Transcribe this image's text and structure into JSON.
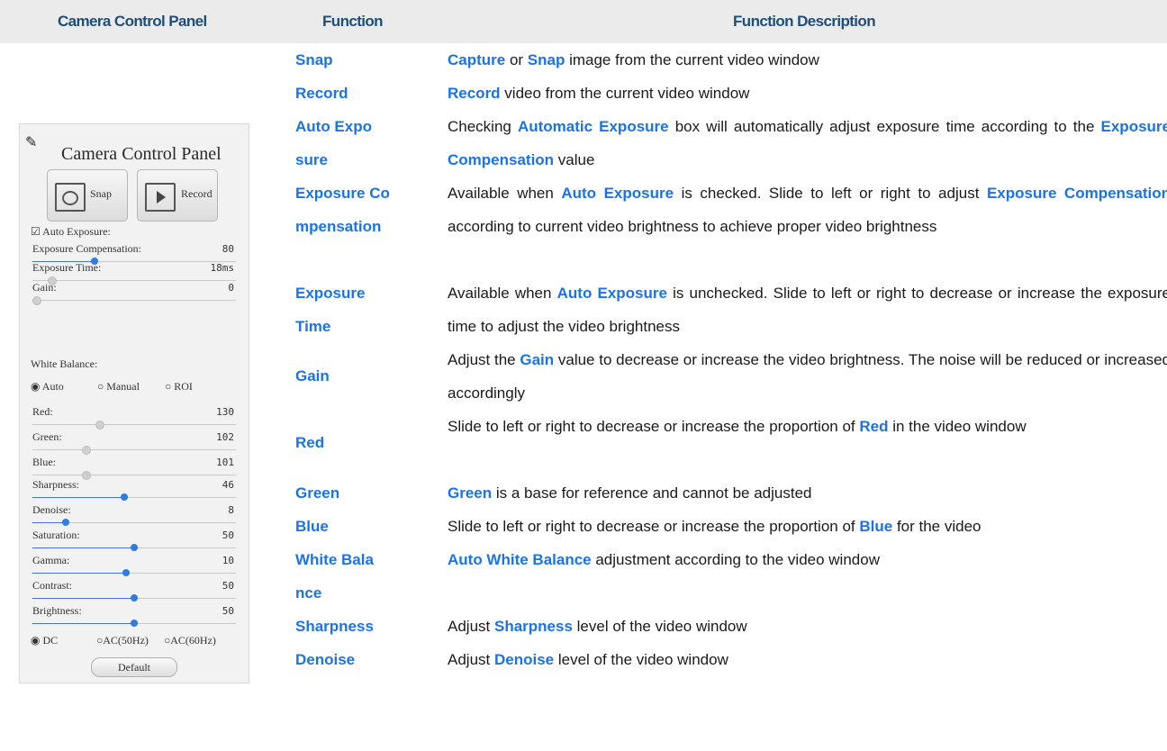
{
  "header": {
    "col1": "Camera Control Panel",
    "col2": "Function",
    "col3": "Function Description"
  },
  "panel": {
    "title": "Camera Control Panel",
    "snap_label": "Snap",
    "record_label": "Record",
    "auto_exposure": "☑ Auto Exposure:",
    "sliders": [
      {
        "label": "Exposure Compensation:",
        "value": "80",
        "level": 0.3
      },
      {
        "label": "Exposure Time:",
        "value": "18ms",
        "level": 0.08
      },
      {
        "label": "Gain:",
        "value": "0",
        "level": 0.0
      }
    ],
    "white_balance": "White Balance:",
    "wb_options": [
      "◉ Auto",
      "○ Manual",
      "○ ROI"
    ],
    "wb_sliders": [
      {
        "label": "Red:",
        "value": "130",
        "level": 0.32
      },
      {
        "label": "Green:",
        "value": "102",
        "level": 0.25
      },
      {
        "label": "Blue:",
        "value": "101",
        "level": 0.25
      }
    ],
    "adj_sliders": [
      {
        "label": "Sharpness:",
        "value": "46",
        "level": 0.45
      },
      {
        "label": "Denoise:",
        "value": "8",
        "level": 0.15
      },
      {
        "label": "Saturation:",
        "value": "50",
        "level": 0.5
      },
      {
        "label": "Gamma:",
        "value": "10",
        "level": 0.46
      },
      {
        "label": "Contrast:",
        "value": "50",
        "level": 0.5
      },
      {
        "label": "Brightness:",
        "value": "50",
        "level": 0.5
      }
    ],
    "power_options": [
      "◉ DC",
      "○AC(50Hz)",
      "○AC(60Hz)"
    ],
    "default_label": "Default"
  },
  "rows": [
    {
      "fn": "Snap",
      "desc": [
        {
          "t": "Capture",
          "h": true
        },
        {
          "t": " or "
        },
        {
          "t": "Snap",
          "h": true
        },
        {
          "t": " image from the current video window"
        }
      ]
    },
    {
      "fn": "Record",
      "desc": [
        {
          "t": "Record",
          "h": true
        },
        {
          "t": " video from the current video window"
        }
      ]
    },
    {
      "fn": "Auto Exposure",
      "desc": [
        {
          "t": "Checking "
        },
        {
          "t": "Automatic Exposure",
          "h": true
        },
        {
          "t": " box will automatically adjust exposure time according to the "
        },
        {
          "t": "Exposure Compensation",
          "h": true
        },
        {
          "t": " value"
        }
      ]
    },
    {
      "fn": "Exposure Compensation",
      "desc": [
        {
          "t": "Available when "
        },
        {
          "t": "Auto Exposure",
          "h": true
        },
        {
          "t": " is checked. Slide to left or right to adjust "
        },
        {
          "t": "Exposure Compensation",
          "h": true
        },
        {
          "t": " according to current video brightness to achieve proper video brightness"
        }
      ]
    },
    {
      "fn": "Exposure Time",
      "desc": [
        {
          "t": "Available when "
        },
        {
          "t": "Auto Exposure",
          "h": true
        },
        {
          "t": " is unchecked. Slide to left or right to decrease or increase the exposure time to adjust the video brightness"
        }
      ]
    },
    {
      "fn": "Gain",
      "desc": [
        {
          "t": "Adjust the "
        },
        {
          "t": "Gain",
          "h": true
        },
        {
          "t": " value to decrease or increase the video brightness. The noise will be reduced or increased accordingly"
        }
      ]
    },
    {
      "fn": "Red",
      "desc": [
        {
          "t": "Slide to left or right to decrease or increase the proportion of "
        },
        {
          "t": "Red",
          "h": true
        },
        {
          "t": " in the video window"
        }
      ]
    },
    {
      "fn": "Green",
      "desc": [
        {
          "t": "Green",
          "h": true
        },
        {
          "t": " is a base for reference and cannot be adjusted"
        }
      ]
    },
    {
      "fn": "Blue",
      "desc": [
        {
          "t": "Slide to left or right to decrease or increase the proportion of "
        },
        {
          "t": "Blue",
          "h": true
        },
        {
          "t": " for the video"
        }
      ]
    },
    {
      "fn": "White Balance",
      "desc": [
        {
          "t": "Auto White Balance",
          "h": true
        },
        {
          "t": " adjustment according to the video window"
        }
      ]
    },
    {
      "fn": "Sharpness",
      "desc": [
        {
          "t": "Adjust "
        },
        {
          "t": "Sharpness",
          "h": true
        },
        {
          "t": " level of the video window"
        }
      ]
    },
    {
      "fn": "Denoise",
      "desc": [
        {
          "t": "Adjust "
        },
        {
          "t": "Denoise",
          "h": true
        },
        {
          "t": " level of the video window"
        }
      ]
    }
  ]
}
